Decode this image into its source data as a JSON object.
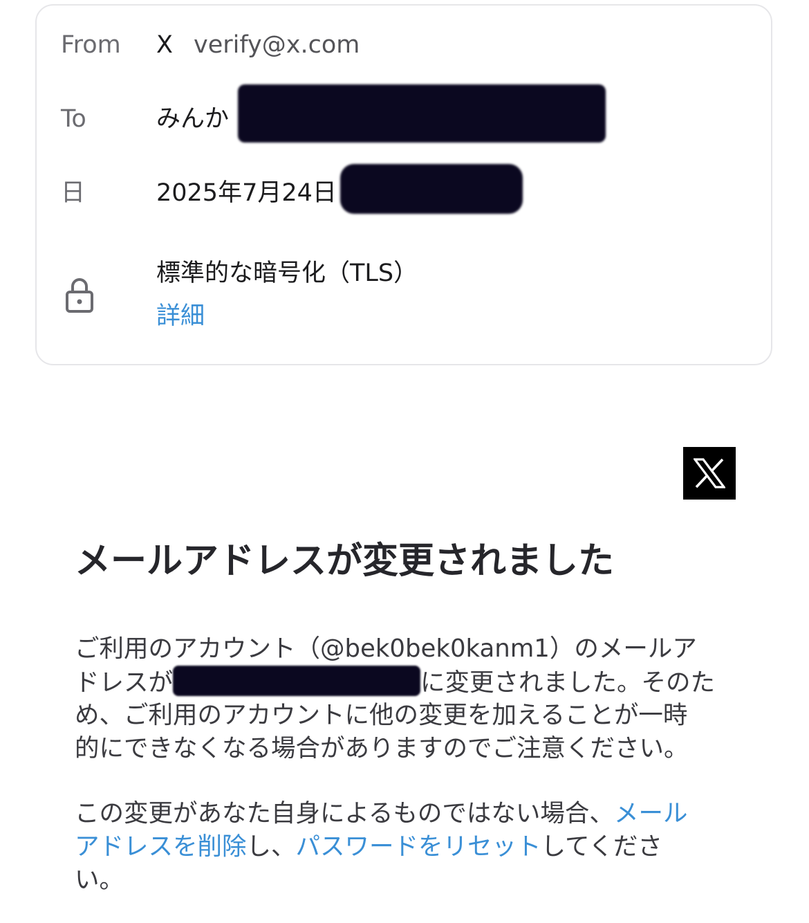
{
  "header": {
    "from_label": "From",
    "from_name": "X",
    "from_email": "verify@x.com",
    "to_label": "To",
    "to_value": "みんか",
    "date_label": "日",
    "date_value": "2025年7月24日",
    "encryption_text": "標準的な暗号化（TLS）",
    "details_link": "詳細"
  },
  "logo": {
    "text": "X"
  },
  "email": {
    "headline": "メールアドレスが変更されました",
    "para1_line1": "ご利用のアカウント（@bek0bek0kanm1）のメールア",
    "para1_line2_a": "ドレスが",
    "para1_line2_b": "に変更されました。そのた",
    "para1_line3": "め、ご利用のアカウントに他の変更を加えることが一時",
    "para1_line4": "的にできなくなる場合がありますのでご注意ください。",
    "para2_line1_text": "この変更があなた自身によるものではない場合、",
    "para2_line1_link": "メール",
    "para2_line2_link1": "アドレスを削除",
    "para2_line2_mid": "し、",
    "para2_line2_link2": "パスワードをリセット",
    "para2_line2_end": "してくださ",
    "para2_line3": "い。"
  },
  "colors": {
    "link": "#3a8fd6",
    "redaction": "#0b0820",
    "logo_bg": "#000000"
  },
  "icons": {
    "lock": "lock-icon",
    "brand": "x-logo-icon"
  }
}
